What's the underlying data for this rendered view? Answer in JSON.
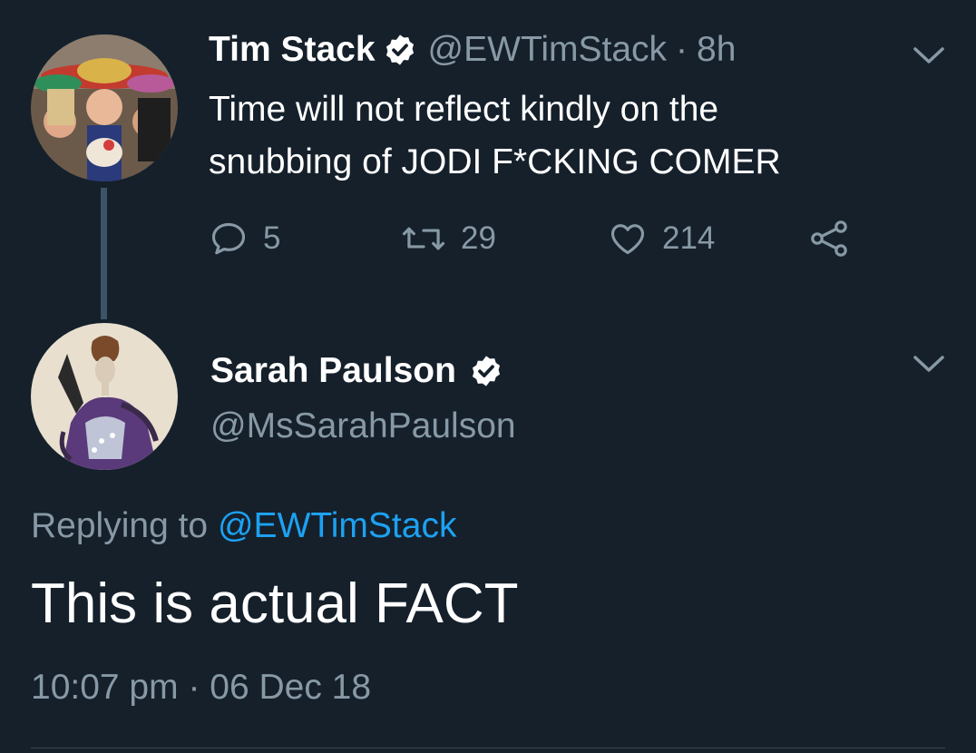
{
  "tweet1": {
    "author_name": "Tim Stack",
    "handle": "@EWTimStack",
    "separator": "·",
    "time": "8h",
    "text_line1": "Time will not reflect kindly on the",
    "text_line2": "snubbing of JODI F*CKING COMER",
    "reply_count": "5",
    "retweet_count": "29",
    "like_count": "214",
    "icons": {
      "reply": "reply-icon",
      "retweet": "retweet-icon",
      "like": "heart-icon",
      "share": "share-icon",
      "verified": "verified-badge-icon",
      "menu": "chevron-down-icon"
    }
  },
  "tweet2": {
    "author_name": "Sarah Paulson",
    "handle": "@MsSarahPaulson",
    "replying_prefix": "Replying to",
    "replying_mention": "@EWTimStack",
    "text": "This is actual FACT",
    "timestamp": "10:07 pm · 06 Dec 18"
  },
  "colors": {
    "background": "#15202b",
    "primary_text": "#ffffff",
    "secondary_text": "#8899a6",
    "link": "#1da1f2",
    "thread_line": "#3d5466"
  }
}
